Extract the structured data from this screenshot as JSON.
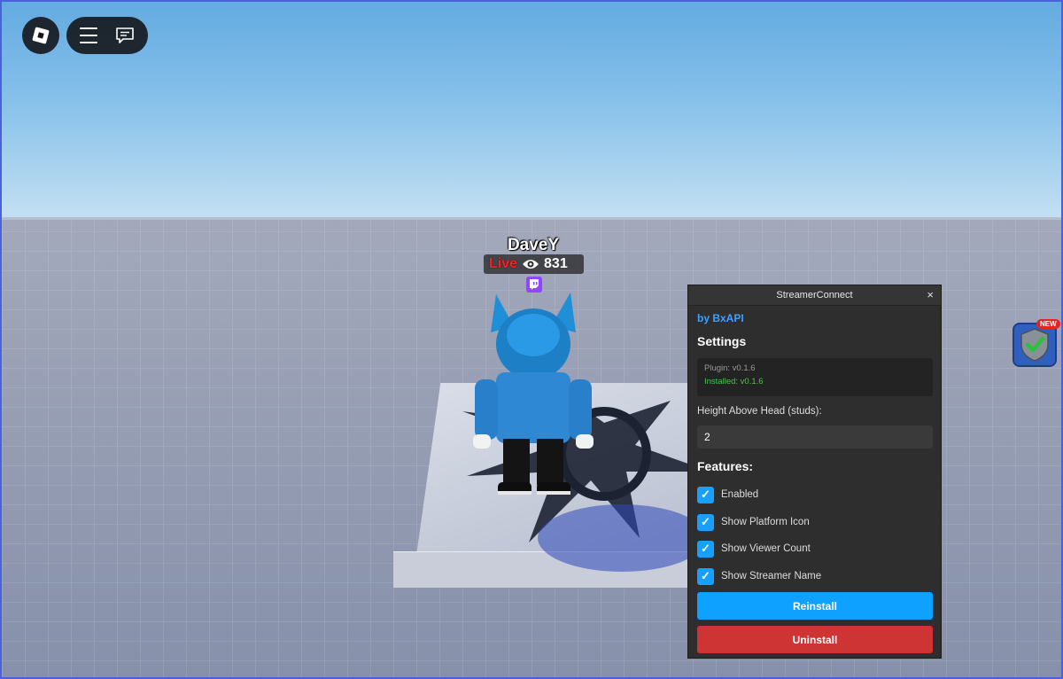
{
  "nametag": {
    "name": "DaveY",
    "live_label": "Live",
    "viewer_count": "831"
  },
  "shield_widget": {
    "badge": "NEW"
  },
  "plugin": {
    "title": "StreamerConnect",
    "close_glyph": "×",
    "by_label": "by BxAPI",
    "settings_heading": "Settings",
    "version_plugin": "Plugin: v0.1.6",
    "version_installed": "Installed: v0.1.6",
    "height_label": "Height Above Head (studs):",
    "height_value": "2",
    "features_heading": "Features:",
    "features": [
      {
        "label": "Enabled",
        "checked": true
      },
      {
        "label": "Show Platform Icon",
        "checked": true
      },
      {
        "label": "Show Viewer Count",
        "checked": true
      },
      {
        "label": "Show Streamer Name",
        "checked": true
      }
    ],
    "check_glyph": "✓",
    "reinstall_label": "Reinstall",
    "uninstall_label": "Uninstall"
  },
  "colors": {
    "accent": "#0ea1ff",
    "danger": "#cf3434",
    "installed": "#4cc34c",
    "live": "#ff1e1e"
  }
}
